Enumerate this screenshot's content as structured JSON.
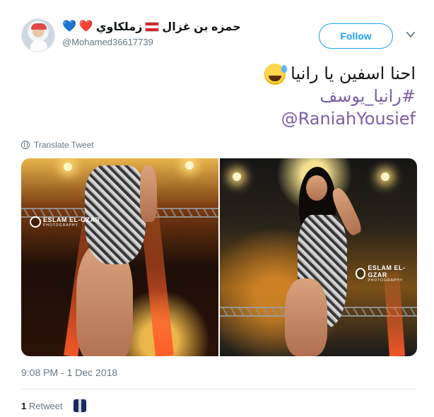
{
  "user": {
    "display_name_prefix": "زملكاوي",
    "display_name_suffix": "حمزه بن غزال",
    "heart_red": "❤️",
    "heart_blue": "💙",
    "handle": "@Mohamed36617739"
  },
  "actions": {
    "follow_label": "Follow"
  },
  "tweet": {
    "line1": "احنا اسفين يا رانيا",
    "hashtag": "#رانيا_يوسف",
    "mention": "@RaniahYousief"
  },
  "translate_label": "Translate Tweet",
  "media": {
    "watermark_left": "ESLAM EL-GZAR",
    "watermark_right": "ESLAM EL-GZAR",
    "watermark_sub": "PHOTOGRAPHY"
  },
  "timestamp": "9:08 PM - 1 Dec 2018",
  "stats": {
    "retweet_count": "1",
    "retweet_label": "Retweet"
  },
  "colors": {
    "accent": "#1da1f2",
    "link": "#7b5ea7",
    "muted": "#657786"
  }
}
